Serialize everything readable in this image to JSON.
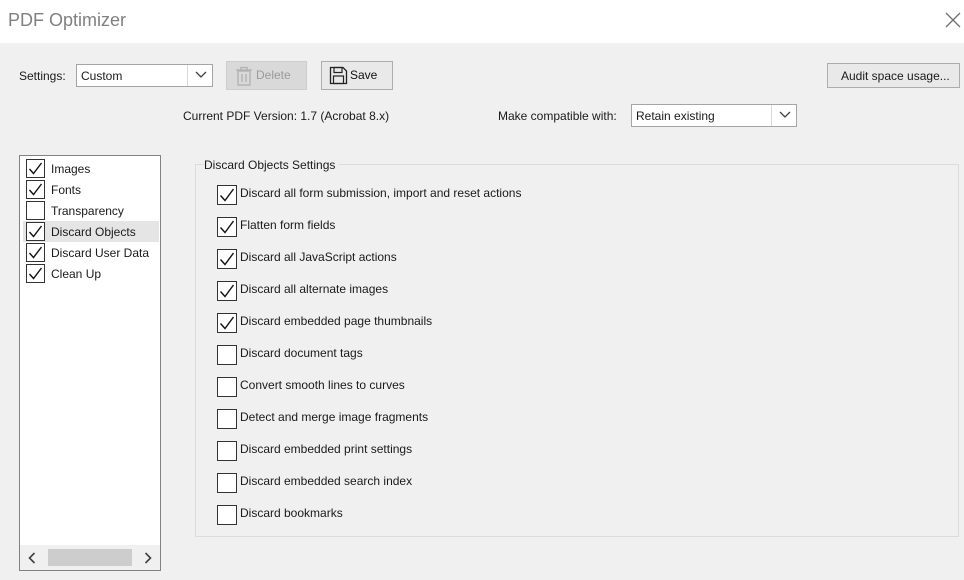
{
  "window": {
    "title": "PDF Optimizer",
    "close_icon": "close-icon"
  },
  "toolbar": {
    "settings_label": "Settings:",
    "settings_value": "Custom",
    "delete_label": "Delete",
    "save_label": "Save",
    "audit_label": "Audit space usage..."
  },
  "version": {
    "current_text": "Current PDF Version: 1.7 (Acrobat 8.x)",
    "compat_label": "Make compatible with:",
    "compat_value": "Retain existing"
  },
  "sidebar": {
    "items": [
      {
        "label": "Images",
        "checked": true
      },
      {
        "label": "Fonts",
        "checked": true
      },
      {
        "label": "Transparency",
        "checked": false
      },
      {
        "label": "Discard Objects",
        "checked": true,
        "selected": true
      },
      {
        "label": "Discard User Data",
        "checked": true
      },
      {
        "label": "Clean Up",
        "checked": true
      }
    ]
  },
  "discard_objects": {
    "title": "Discard Objects Settings",
    "options": [
      {
        "label": "Discard all form submission, import and reset actions",
        "checked": true
      },
      {
        "label": "Flatten form fields",
        "checked": true
      },
      {
        "label": "Discard all JavaScript actions",
        "checked": true
      },
      {
        "label": "Discard all alternate images",
        "checked": true
      },
      {
        "label": "Discard embedded page thumbnails",
        "checked": true
      },
      {
        "label": "Discard document tags",
        "checked": false
      },
      {
        "label": "Convert smooth lines to curves",
        "checked": false
      },
      {
        "label": "Detect and merge image fragments",
        "checked": false
      },
      {
        "label": "Discard embedded print settings",
        "checked": false
      },
      {
        "label": "Discard embedded search index",
        "checked": false
      },
      {
        "label": "Discard bookmarks",
        "checked": false
      }
    ]
  },
  "colors": {
    "background": "#f0f0f0",
    "title_text": "#808080",
    "border": "#a5a5a5"
  }
}
